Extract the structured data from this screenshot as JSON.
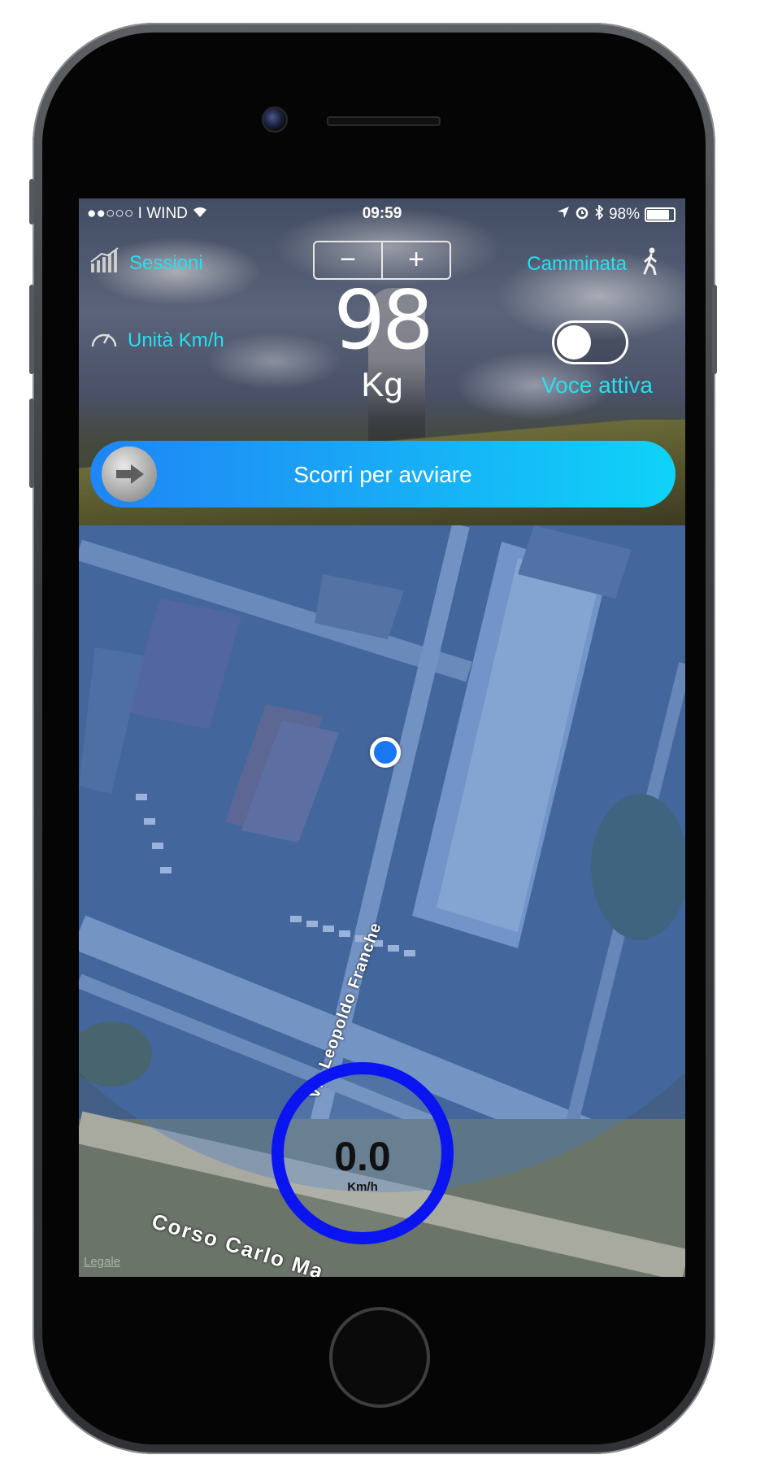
{
  "status_bar": {
    "signal": "●●○○○",
    "carrier": "I WIND",
    "time": "09:59",
    "battery": "98%",
    "battery_level": 0.98
  },
  "header": {
    "sessions_label": "Sessioni",
    "units_label": "Unità Km/h",
    "activity_label": "Camminata",
    "stepper_minus": "−",
    "stepper_plus": "+",
    "weight_value": "98",
    "weight_unit": "Kg",
    "voice_label": "Voce attiva",
    "voice_enabled": false
  },
  "slider": {
    "label": "Scorri per avviare"
  },
  "map": {
    "street_1": "Via Leopoldo Franche",
    "street_2": "Corso Carlo Ma",
    "legal": "Legale"
  },
  "speedometer": {
    "value": "0.0",
    "unit": "Km/h"
  },
  "colors": {
    "accent_cyan": "#27e0f0",
    "speed_ring": "#0a14f0",
    "location_dot": "#1877f2",
    "slider_start": "#1e85f5",
    "slider_end": "#0fd3f8"
  }
}
